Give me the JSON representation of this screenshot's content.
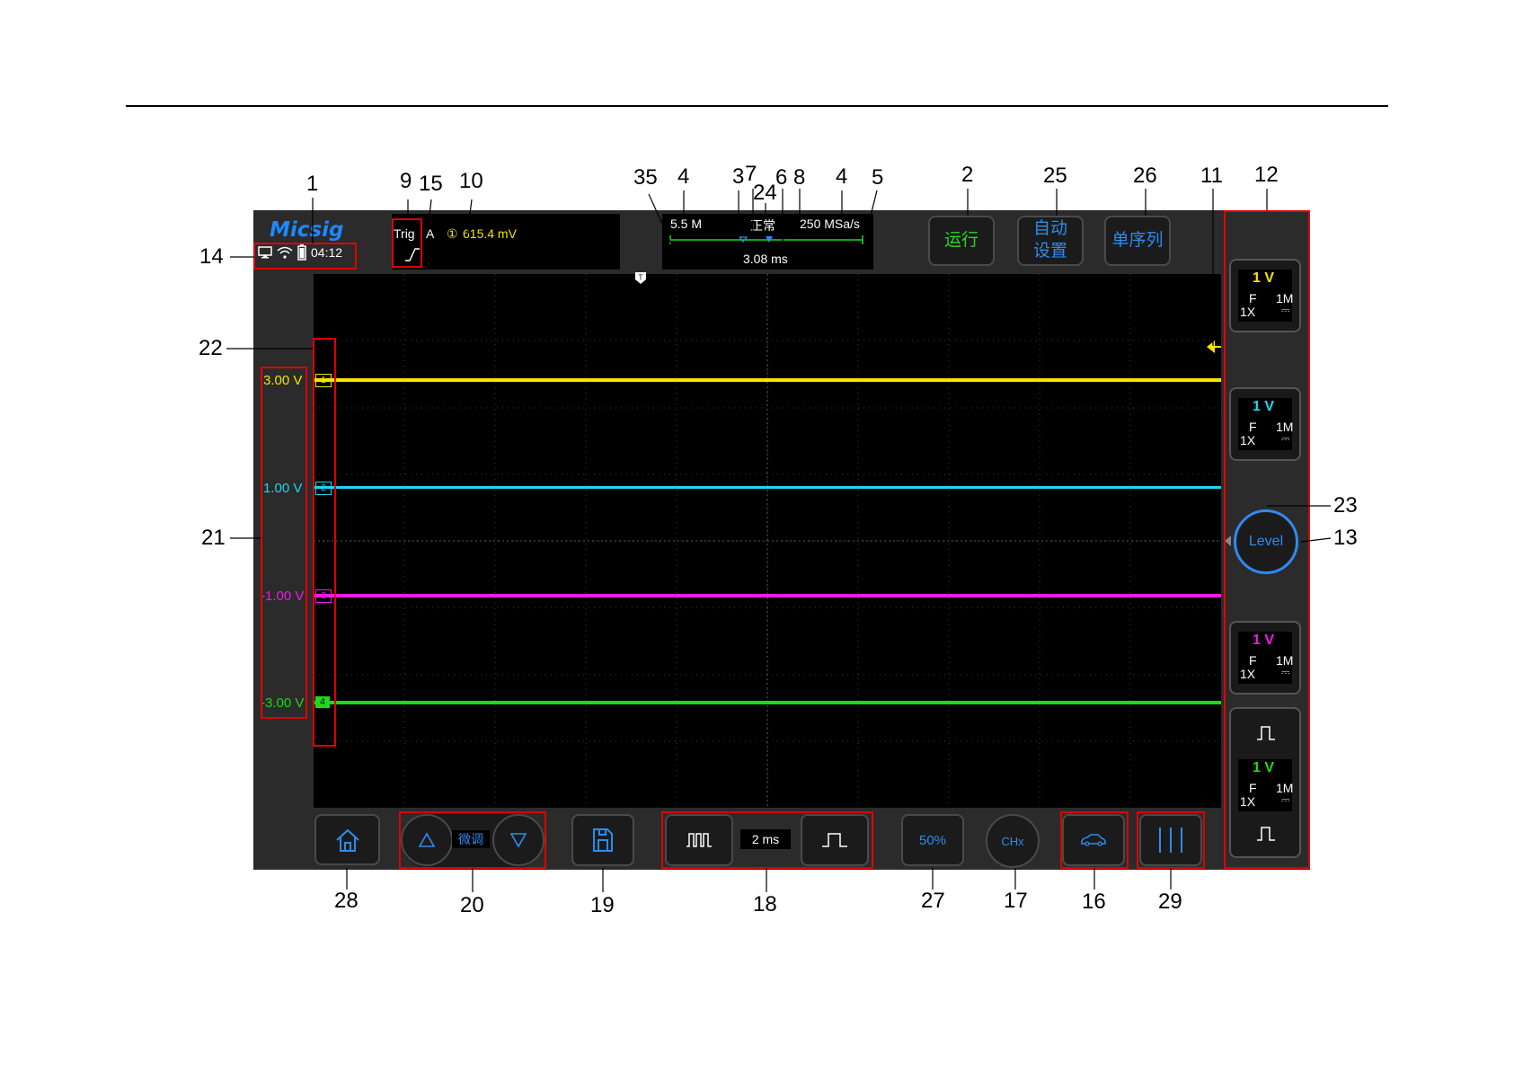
{
  "device": {
    "logo": "Micsig",
    "status": {
      "time": "04:12",
      "icons": [
        "monitor-icon",
        "wifi-icon",
        "battery-icon"
      ]
    },
    "trigger": {
      "label": "Trig",
      "source": "A",
      "channel_marker": "①",
      "level": "615.4 mV"
    },
    "timebase": {
      "memory_depth": "5.5 M",
      "mode": "正常",
      "sample_rate": "250 MSa/s",
      "position": "3.08 ms"
    },
    "buttons": {
      "run": "运行",
      "auto_setup_line1": "自动",
      "auto_setup_line2": "设置",
      "single": "单序列"
    },
    "channels": [
      {
        "num": "1",
        "color": "#f4e400",
        "offset_label": "3.00 V",
        "scale": "1 V",
        "coupling": "F",
        "impedance": "1M",
        "probe": "1X",
        "dc_symbol": "⎓"
      },
      {
        "num": "2",
        "color": "#1ad8f0",
        "offset_label": "1.00 V",
        "scale": "1 V",
        "coupling": "F",
        "impedance": "1M",
        "probe": "1X",
        "dc_symbol": "⎓"
      },
      {
        "num": "3",
        "color": "#f01ae8",
        "offset_label": "-1.00 V",
        "scale": "1 V",
        "coupling": "F",
        "impedance": "1M",
        "probe": "1X",
        "dc_symbol": "⎓"
      },
      {
        "num": "4",
        "color": "#1adb1a",
        "offset_label": "-3.00 V",
        "scale": "1 V",
        "coupling": "F",
        "impedance": "1M",
        "probe": "1X",
        "dc_symbol": "⎓"
      }
    ],
    "trigger_marker": "T",
    "level_button": "Level",
    "fine_tune": "微调",
    "time_scale": "2 ms",
    "fifty_percent": "50%",
    "chx": "CHx",
    "colors": {
      "run": "#29d629",
      "accent": "#2e8bf0",
      "callout_box": "#e00000"
    }
  },
  "callouts": [
    "1",
    "2",
    "3",
    "4",
    "4",
    "5",
    "6",
    "7",
    "8",
    "9",
    "10",
    "11",
    "12",
    "13",
    "14",
    "15",
    "16",
    "17",
    "18",
    "19",
    "20",
    "21",
    "22",
    "23",
    "24",
    "25",
    "26",
    "27",
    "28",
    "29",
    "35"
  ]
}
